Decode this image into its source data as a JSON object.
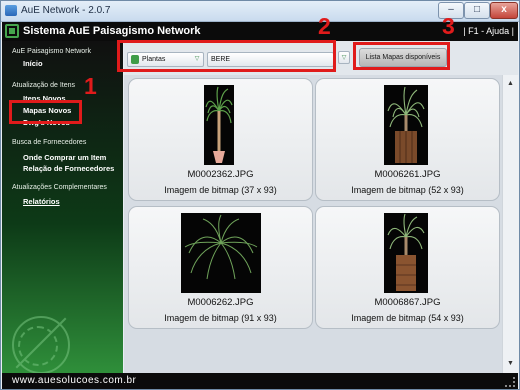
{
  "window": {
    "title": "AuE Network - 2.0.7",
    "min": "–",
    "max": "□",
    "close": "x"
  },
  "header": {
    "title": "Sistema AuE Paisagismo Network",
    "help": "| F1 - Ajuda |"
  },
  "sidebar": {
    "s1": {
      "title": "AuE Paisagismo Network",
      "link": "Início"
    },
    "s2": {
      "title": "Atualização de Itens",
      "items": [
        "Itens Novos",
        "Mapas Novos",
        "Dwg's Novos"
      ]
    },
    "s3": {
      "title": "Busca de Fornecedores",
      "items": [
        "Onde Comprar um Item",
        "Relação de Fornecedores"
      ]
    },
    "s4": {
      "title": "Atualizações Complementares",
      "items": [
        "Relatórios"
      ]
    }
  },
  "toolbar": {
    "category": "Plantas",
    "subcategory": "BERE",
    "list_button": "Lista Mapas disponíveis"
  },
  "annotations": [
    "1",
    "2",
    "3"
  ],
  "cards": [
    {
      "name": "M0002362.JPG",
      "desc": "Imagem de bitmap (37 x 93)"
    },
    {
      "name": "M0006261.JPG",
      "desc": "Imagem de bitmap (52 x 93)"
    },
    {
      "name": "M0006262.JPG",
      "desc": "Imagem de bitmap (91 x 93)"
    },
    {
      "name": "M0006867.JPG",
      "desc": "Imagem de bitmap (54 x 93)"
    }
  ],
  "footer": {
    "url": "www.auesolucoes.com.br"
  },
  "colors": {
    "annotation": "#e01b1b",
    "sidebar_green": "#2f8f3a",
    "header": "#0b0b0b"
  },
  "icons": [
    "app-icon",
    "logo-icon",
    "leaf-icon",
    "dropdown-arrow-icon",
    "scroll-up-icon",
    "scroll-down-icon",
    "resize-grip-icon",
    "plant-image"
  ]
}
